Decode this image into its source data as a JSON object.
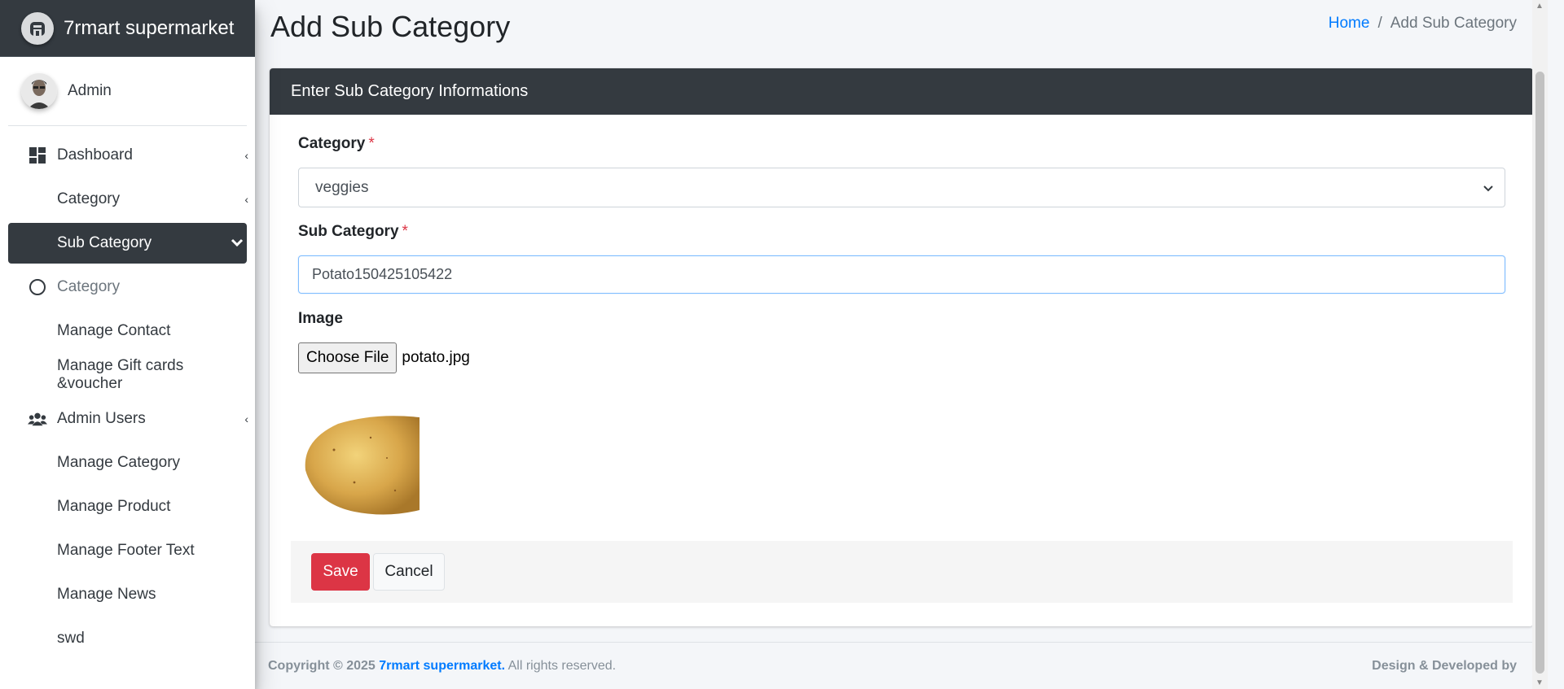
{
  "brand": {
    "name": "7rmart supermarket"
  },
  "user": {
    "name": "Admin"
  },
  "sidebar": {
    "items": [
      {
        "label": "Dashboard",
        "icon": "dashboard-icon"
      },
      {
        "label": "Category"
      },
      {
        "label": "Sub Category"
      },
      {
        "label": "Category",
        "icon": "circle-icon"
      },
      {
        "label": "Manage Contact"
      },
      {
        "label": "Manage Gift cards &voucher"
      },
      {
        "label": "Admin Users",
        "icon": "users-icon"
      },
      {
        "label": "Manage Category"
      },
      {
        "label": "Manage Product"
      },
      {
        "label": "Manage Footer Text"
      },
      {
        "label": "Manage News"
      },
      {
        "label": "swd"
      }
    ]
  },
  "page": {
    "title": "Add Sub Category"
  },
  "breadcrumb": {
    "home": "Home",
    "separator": "/",
    "current": "Add Sub Category"
  },
  "form": {
    "header": "Enter Sub Category Informations",
    "category_label": "Category",
    "category_value": "veggies",
    "subcategory_label": "Sub Category",
    "subcategory_value": "Potato150425105422",
    "image_label": "Image",
    "file_button": "Choose File",
    "file_name": "potato.jpg",
    "required_mark": "*",
    "save_label": "Save",
    "cancel_label": "Cancel"
  },
  "footer": {
    "copyright": "Copyright © 2025",
    "brand": "7rmart supermarket.",
    "rights": "All rights reserved.",
    "credit": "Design & Developed by"
  },
  "colors": {
    "accent": "#007bff",
    "danger": "#dc3545",
    "dark": "#343a40"
  }
}
